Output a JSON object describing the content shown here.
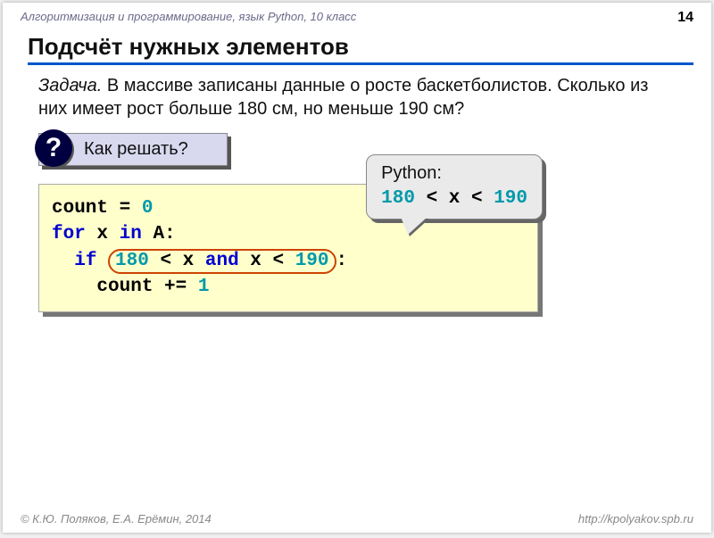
{
  "topbar": {
    "course": "Алгоритмизация и программирование, язык Python, 10 класс",
    "page": "14"
  },
  "title": "Подсчёт нужных элементов",
  "task": {
    "label": "Задача.",
    "text": " В массиве записаны данные о росте баскетболистов. Сколько из них имеет рост больше 180 см, но меньше 190 см?"
  },
  "question": {
    "mark": "?",
    "text": "Как решать?"
  },
  "code": {
    "line1_a": "count = ",
    "line1_b": "0",
    "line2_a": "for",
    "line2_b": " x ",
    "line2_c": "in",
    "line2_d": " A:",
    "line3_a": "  ",
    "line3_b": "if",
    "line3_c1": "180",
    "line3_c2": " < x ",
    "line3_c3": "and",
    "line3_c4": " x < ",
    "line3_c5": "190",
    "line3_d": ":",
    "line4_a": "    count += ",
    "line4_b": "1"
  },
  "pycallout": {
    "label": "Python:",
    "n1": "180",
    "mid": " < x < ",
    "n2": "190"
  },
  "footer": {
    "left": "© К.Ю. Поляков, Е.А. Ерёмин, 2014",
    "right": "http://kpolyakov.spb.ru"
  }
}
